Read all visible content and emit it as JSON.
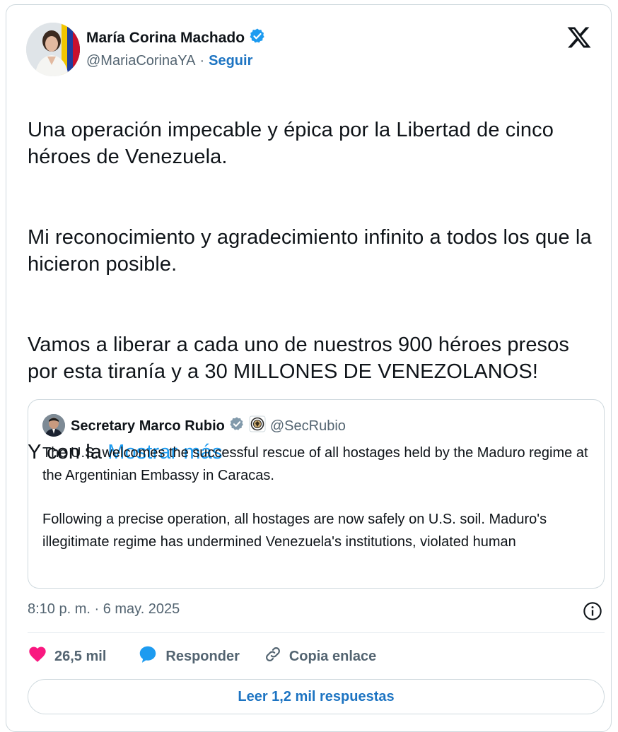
{
  "author": {
    "name": "María Corina Machado",
    "handle": "@MariaCorinaYA",
    "separator": "·",
    "follow_label": "Seguir"
  },
  "tweet": {
    "paragraphs": [
      "Una operación impecable y épica por la Libertad de cinco héroes de Venezuela.",
      "Mi reconocimiento y agradecimiento infinito a todos los que la hicieron posible.",
      "Vamos a liberar a cada uno de nuestros 900 héroes presos por esta tiranía y a 30 MILLONES DE VENEZOLANOS!"
    ],
    "last_line": "Y con la ",
    "show_more": "Mostrar más"
  },
  "quote": {
    "name": "Secretary Marco Rubio",
    "handle": "@SecRubio",
    "paragraphs": [
      "The U.S. welcomes the successful rescue of all hostages held by the Maduro regime at the Argentinian Embassy in Caracas.",
      "Following a precise operation, all hostages are now safely on U.S. soil. Maduro's illegitimate regime has undermined Venezuela's institutions, violated human"
    ]
  },
  "timestamp": "8:10 p. m. · 6 may. 2025",
  "actions": {
    "likes": "26,5 mil",
    "reply": "Responder",
    "copy_link": "Copia enlace"
  },
  "read_replies": "Leer 1,2 mil respuestas",
  "colors": {
    "accent": "#1d9bf0",
    "link": "#1d74c2",
    "heart": "#f91880",
    "verified": "#1d9bf0",
    "muted": "#536471"
  },
  "icons": [
    "verified-badge-icon",
    "x-logo-icon",
    "gray-verified-badge-icon",
    "state-department-seal-icon",
    "info-icon",
    "heart-icon",
    "reply-bubble-icon",
    "link-icon"
  ]
}
